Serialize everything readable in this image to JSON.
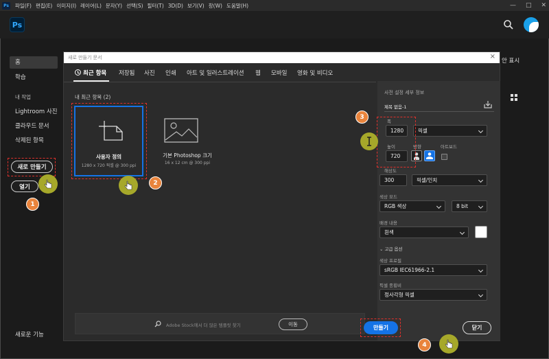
{
  "menubar": {
    "app_icon": "Ps",
    "items": [
      "파일(F)",
      "편집(E)",
      "이미지(I)",
      "레이어(L)",
      "문자(Y)",
      "선택(S)",
      "필터(T)",
      "3D(D)",
      "보기(V)",
      "창(W)",
      "도움말(H)"
    ]
  },
  "header": {
    "logo": "Ps"
  },
  "sidebar": {
    "home": "홈",
    "learn": "학습",
    "my_work": "내 작업",
    "lightroom": "Lightroom 사진",
    "cloud_docs": "클라우드 문서",
    "deleted": "삭제된 항목",
    "new_button": "새로 만들기",
    "open_button": "열기",
    "whats_new": "새로운 기능"
  },
  "background": {
    "show_text": "안 표시"
  },
  "dialog": {
    "title": "새로 만들기 문서",
    "close": "×",
    "tabs": [
      "최근 항목",
      "저장됨",
      "사진",
      "인쇄",
      "아트 및 일러스트레이션",
      "웹",
      "모바일",
      "영화 및 비디오"
    ],
    "recent_label": "내 최근 항목",
    "recent_count": "(2)",
    "presets": [
      {
        "name": "사용자 정의",
        "size": "1280 x 720 픽셀 @ 300 ppi"
      },
      {
        "name": "기본 Photoshop 크기",
        "size": "16 x 12 cm @ 300 ppi"
      }
    ],
    "stock_placeholder": "Adobe Stock에서 더 많은 템플릿 찾기",
    "stock_button": "이동"
  },
  "panel": {
    "heading": "사전 설정 세부 정보",
    "doc_name": "제목 없음-1",
    "width_label": "폭",
    "width_value": "1280",
    "unit": "픽셀",
    "height_label": "높이",
    "height_value": "720",
    "orientation_label": "방향",
    "artboard_label": "아트보드",
    "resolution_label": "해상도",
    "resolution_value": "300",
    "resolution_unit": "픽셀/인치",
    "color_mode_label": "색상 모드",
    "color_mode": "RGB 색상",
    "bit_depth": "8 bit",
    "bg_label": "배경 내용",
    "bg_value": "흰색",
    "bg_color": "#ffffff",
    "advanced": "고급 옵션",
    "profile_label": "색상 프로필",
    "profile_value": "sRGB IEC61966-2.1",
    "aspect_label": "픽셀 종횡비",
    "aspect_value": "정사각형 픽셀"
  },
  "buttons": {
    "create": "만들기",
    "close": "닫기"
  },
  "annotations": {
    "b1": "1",
    "b2": "2",
    "b3": "3",
    "b4": "4"
  },
  "colors": {
    "accent": "#1473e6",
    "annotation": "#e9843c",
    "highlight": "#e0302b",
    "pointer": "#a6a82a"
  }
}
